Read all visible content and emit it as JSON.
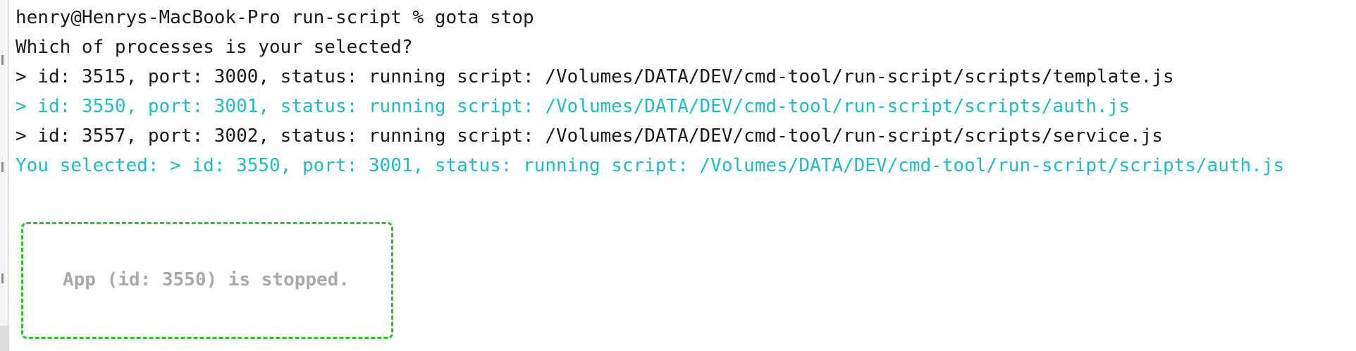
{
  "terminal": {
    "prompt_line": "henry@Henrys-MacBook-Pro run-script % gota stop",
    "question": "Which of processes is your selected?",
    "options": [
      {
        "text": "> id: 3515, port: 3000, status: running script: /Volumes/DATA/DEV/cmd-tool/run-script/scripts/template.js",
        "highlighted": false
      },
      {
        "text": "> id: 3550, port: 3001, status: running script: /Volumes/DATA/DEV/cmd-tool/run-script/scripts/auth.js",
        "highlighted": true
      },
      {
        "text": "> id: 3557, port: 3002, status: running script: /Volumes/DATA/DEV/cmd-tool/run-script/scripts/service.js",
        "highlighted": false
      }
    ],
    "selection": "You selected: > id: 3550, port: 3001, status: running script: /Volumes/DATA/DEV/cmd-tool/run-script/scripts/auth.js",
    "result_box": {
      "message": "App (id: 3550) is stopped."
    }
  },
  "colors": {
    "text": "#1a1a1a",
    "highlight": "#1fbdbd",
    "box_border": "#2bc22b",
    "box_text": "#a9a9a9",
    "background": "#ffffff"
  }
}
